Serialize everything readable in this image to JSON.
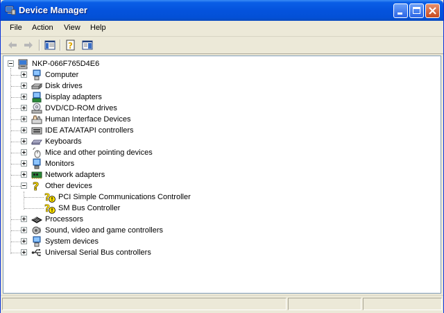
{
  "window": {
    "title": "Device Manager"
  },
  "menu": {
    "items": [
      {
        "label": "File"
      },
      {
        "label": "Action"
      },
      {
        "label": "View"
      },
      {
        "label": "Help"
      }
    ]
  },
  "tree": {
    "root": {
      "label": "NKP-066F765D4E6",
      "icon": "computer-icon",
      "expanded": true
    },
    "items": [
      {
        "label": "Computer",
        "icon": "computer-icon",
        "expanded": false
      },
      {
        "label": "Disk drives",
        "icon": "disk-drive-icon",
        "expanded": false
      },
      {
        "label": "Display adapters",
        "icon": "display-adapter-icon",
        "expanded": false
      },
      {
        "label": "DVD/CD-ROM drives",
        "icon": "dvd-drive-icon",
        "expanded": false
      },
      {
        "label": "Human Interface Devices",
        "icon": "hid-icon",
        "expanded": false
      },
      {
        "label": "IDE ATA/ATAPI controllers",
        "icon": "ide-controller-icon",
        "expanded": false
      },
      {
        "label": "Keyboards",
        "icon": "keyboard-icon",
        "expanded": false
      },
      {
        "label": "Mice and other pointing devices",
        "icon": "mouse-icon",
        "expanded": false
      },
      {
        "label": "Monitors",
        "icon": "monitor-icon",
        "expanded": false
      },
      {
        "label": "Network adapters",
        "icon": "network-adapter-icon",
        "expanded": false
      },
      {
        "label": "Other devices",
        "icon": "unknown-device-icon",
        "expanded": true,
        "children": [
          {
            "label": "PCI Simple Communications Controller",
            "icon": "warning-device-icon"
          },
          {
            "label": "SM Bus Controller",
            "icon": "warning-device-icon"
          }
        ]
      },
      {
        "label": "Processors",
        "icon": "processor-icon",
        "expanded": false
      },
      {
        "label": "Sound, video and game controllers",
        "icon": "sound-icon",
        "expanded": false
      },
      {
        "label": "System devices",
        "icon": "system-device-icon",
        "expanded": false
      },
      {
        "label": "Universal Serial Bus controllers",
        "icon": "usb-icon",
        "expanded": false
      }
    ]
  },
  "colors": {
    "titlebar": "#0453dd",
    "frame": "#ece9d8",
    "warning": "#ffe000"
  }
}
